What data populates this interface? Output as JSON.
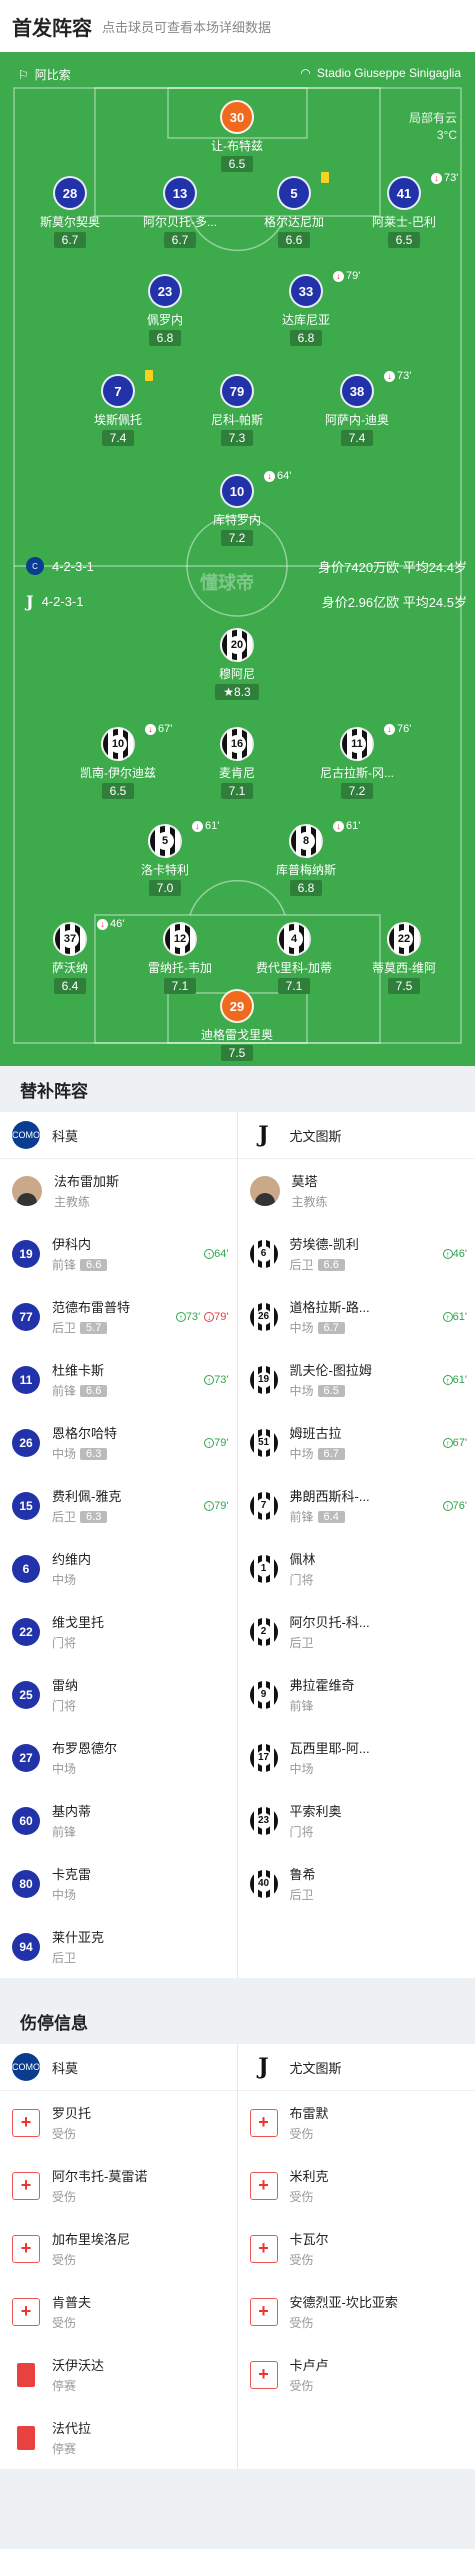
{
  "header": {
    "title": "首发阵容",
    "subtitle": "点击球员可查看本场详细数据"
  },
  "pitch": {
    "home_team": "阿比索",
    "venue": "Stadio Giuseppe Sinigaglia",
    "weather": "局部有云",
    "temp": "3°C",
    "home_formation": "4-2-3-1",
    "home_value": "身价7420万欧 平均24.4岁",
    "away_formation": "4-2-3-1",
    "away_value": "身价2.96亿欧 平均24.5岁",
    "watermark": "懂球帝",
    "home_players": [
      {
        "num": "30",
        "name": "让-布特兹",
        "rating": "6.5",
        "gk": true
      },
      {
        "num": "28",
        "name": "斯莫尔契奥",
        "rating": "6.7"
      },
      {
        "num": "13",
        "name": "阿尔贝托-多...",
        "rating": "6.7"
      },
      {
        "num": "5",
        "name": "格尔达尼加",
        "rating": "6.6",
        "ev": "yc"
      },
      {
        "num": "41",
        "name": "阿莱士-巴利",
        "rating": "6.5",
        "ev": "73'"
      },
      {
        "num": "23",
        "name": "佩罗内",
        "rating": "6.8"
      },
      {
        "num": "33",
        "name": "达库尼亚",
        "rating": "6.8",
        "ev": "79'"
      },
      {
        "num": "7",
        "name": "埃斯佩托",
        "rating": "7.4",
        "ev": "yc"
      },
      {
        "num": "79",
        "name": "尼科-帕斯",
        "rating": "7.3"
      },
      {
        "num": "38",
        "name": "阿萨内-迪奥",
        "rating": "7.4",
        "ev": "73'"
      },
      {
        "num": "10",
        "name": "库特罗内",
        "rating": "7.2",
        "ev": "64'"
      }
    ],
    "away_players": [
      {
        "num": "20",
        "name": "穆阿尼",
        "rating": "8.3",
        "best": true
      },
      {
        "num": "10",
        "name": "凯南-伊尔迪兹",
        "rating": "6.5",
        "ev": "67'"
      },
      {
        "num": "16",
        "name": "麦肯尼",
        "rating": "7.1"
      },
      {
        "num": "11",
        "name": "尼古拉斯-冈...",
        "rating": "7.2",
        "ev": "76'"
      },
      {
        "num": "5",
        "name": "洛卡特利",
        "rating": "7.0",
        "ev": "61'"
      },
      {
        "num": "8",
        "name": "库普梅纳斯",
        "rating": "6.8",
        "ev": "61'"
      },
      {
        "num": "37",
        "name": "萨沃纳",
        "rating": "6.4",
        "ev": "46'"
      },
      {
        "num": "12",
        "name": "雷纳托-韦加",
        "rating": "7.1"
      },
      {
        "num": "4",
        "name": "费代里科-加蒂",
        "rating": "7.1"
      },
      {
        "num": "22",
        "name": "蒂莫西-维阿",
        "rating": "7.5"
      },
      {
        "num": "29",
        "name": "迪格雷戈里奥",
        "rating": "7.5",
        "gk": true
      }
    ]
  },
  "subs": {
    "title": "替补阵容",
    "home_team": "科莫",
    "away_team": "尤文图斯",
    "home_coach": "法布雷加斯",
    "away_coach": "莫塔",
    "coach_label": "主教练",
    "home": [
      {
        "num": "19",
        "name": "伊科内",
        "pos": "前锋",
        "rating": "6.6",
        "in": "64'"
      },
      {
        "num": "77",
        "name": "范德布雷普特",
        "pos": "后卫",
        "rating": "5.7",
        "in": "73'",
        "out": "79'"
      },
      {
        "num": "11",
        "name": "杜维卡斯",
        "pos": "前锋",
        "rating": "6.6",
        "in": "73'"
      },
      {
        "num": "26",
        "name": "恩格尔哈特",
        "pos": "中场",
        "rating": "6.3",
        "in": "79'"
      },
      {
        "num": "15",
        "name": "费利佩-雅克",
        "pos": "后卫",
        "rating": "6.3",
        "in": "79'"
      },
      {
        "num": "6",
        "name": "约维内",
        "pos": "中场"
      },
      {
        "num": "22",
        "name": "维戈里托",
        "pos": "门将"
      },
      {
        "num": "25",
        "name": "雷纳",
        "pos": "门将"
      },
      {
        "num": "27",
        "name": "布罗恩德尔",
        "pos": "中场"
      },
      {
        "num": "60",
        "name": "基内蒂",
        "pos": "前锋"
      },
      {
        "num": "80",
        "name": "卡克雷",
        "pos": "中场"
      },
      {
        "num": "94",
        "name": "莱什亚克",
        "pos": "后卫"
      }
    ],
    "away": [
      {
        "num": "6",
        "name": "劳埃德-凯利",
        "pos": "后卫",
        "rating": "6.6",
        "in": "46'"
      },
      {
        "num": "26",
        "name": "道格拉斯-路...",
        "pos": "中场",
        "rating": "6.7",
        "in": "61'"
      },
      {
        "num": "19",
        "name": "凯夫伦-图拉姆",
        "pos": "中场",
        "rating": "6.5",
        "in": "61'"
      },
      {
        "num": "51",
        "name": "姆班古拉",
        "pos": "中场",
        "rating": "6.7",
        "in": "67'"
      },
      {
        "num": "7",
        "name": "弗朗西斯科-...",
        "pos": "前锋",
        "rating": "6.4",
        "in": "76'"
      },
      {
        "num": "1",
        "name": "佩林",
        "pos": "门将"
      },
      {
        "num": "2",
        "name": "阿尔贝托-科...",
        "pos": "后卫"
      },
      {
        "num": "9",
        "name": "弗拉霍维奇",
        "pos": "前锋"
      },
      {
        "num": "17",
        "name": "瓦西里耶-阿...",
        "pos": "中场"
      },
      {
        "num": "23",
        "name": "平索利奥",
        "pos": "门将"
      },
      {
        "num": "40",
        "name": "鲁希",
        "pos": "后卫"
      }
    ]
  },
  "injuries": {
    "title": "伤停信息",
    "home_team": "科莫",
    "away_team": "尤文图斯",
    "home": [
      {
        "name": "罗贝托",
        "status": "受伤",
        "type": "injury"
      },
      {
        "name": "阿尔韦托-莫雷诺",
        "status": "受伤",
        "type": "injury"
      },
      {
        "name": "加布里埃洛尼",
        "status": "受伤",
        "type": "injury"
      },
      {
        "name": "肯普夫",
        "status": "受伤",
        "type": "injury"
      },
      {
        "name": "沃伊沃达",
        "status": "停赛",
        "type": "suspended"
      },
      {
        "name": "法代拉",
        "status": "停赛",
        "type": "suspended"
      }
    ],
    "away": [
      {
        "name": "布雷默",
        "status": "受伤",
        "type": "injury"
      },
      {
        "name": "米利克",
        "status": "受伤",
        "type": "injury"
      },
      {
        "name": "卡瓦尔",
        "status": "受伤",
        "type": "injury"
      },
      {
        "name": "安德烈亚-坎比亚索",
        "status": "受伤",
        "type": "injury"
      },
      {
        "name": "卡卢卢",
        "status": "受伤",
        "type": "injury"
      }
    ]
  }
}
